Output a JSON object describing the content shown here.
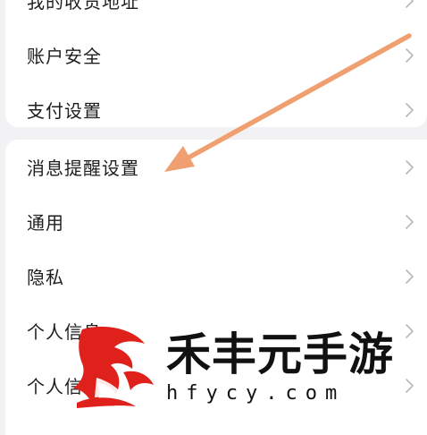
{
  "settings": {
    "group1": [
      {
        "label": "我的收货地址"
      },
      {
        "label": "账户安全"
      },
      {
        "label": "支付设置"
      }
    ],
    "group2": [
      {
        "label": "消息提醒设置"
      },
      {
        "label": "通用"
      },
      {
        "label": "隐私"
      },
      {
        "label": "个人信息"
      },
      {
        "label": "个人信息"
      }
    ]
  },
  "watermark": {
    "title": "禾丰元手游",
    "domain": "hfycy.com"
  },
  "colors": {
    "background": "#f2f2f4",
    "card": "#ffffff",
    "text": "#1e1e1e",
    "chevron": "#b8b8b8",
    "annotation_arrow": "#f0a070",
    "watermark_red": "#e0201a"
  },
  "icons": {
    "row_chevron": "chevron-right-icon",
    "annotation": "arrow-annotation-icon",
    "watermark_logo": "dragon-logo-icon"
  }
}
